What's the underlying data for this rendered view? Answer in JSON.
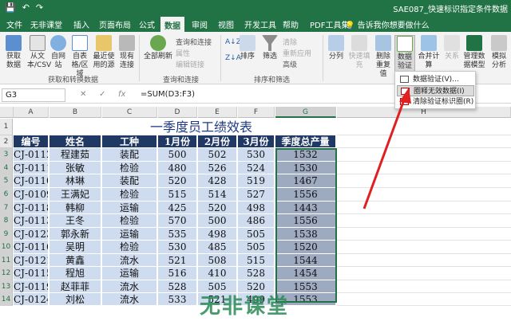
{
  "app": {
    "window_title": "SAE087_快速标识指定条件数据",
    "quick_access": [
      "💾",
      "↶",
      "↷"
    ]
  },
  "tabs": [
    "文件",
    "无非课堂",
    "插入",
    "页面布局",
    "公式",
    "数据",
    "审阅",
    "视图",
    "开发工具",
    "帮助",
    "PDF工具集"
  ],
  "active_tab": "数据",
  "tell_me": "告诉我你想要做什么",
  "ribbon": {
    "get_data": "获取数据",
    "from_text_csv": "从文本/CSV",
    "from_web": "自网站",
    "from_table": "自表格/区域",
    "recent_sources": "最近使用的源",
    "existing_connections": "现有连接",
    "refresh_all": "全部刷新",
    "queries_connections": "查询和连接",
    "properties": "属性",
    "edit_links": "编辑链接",
    "sort_az": "A↓Z",
    "sort_za": "Z↓A",
    "sort": "排序",
    "filter": "筛选",
    "clear": "清除",
    "reapply": "重新应用",
    "advanced": "高级",
    "text_to_columns": "分列",
    "flash_fill": "快速填充",
    "remove_duplicates": "删除重复值",
    "data_validation": "数据验证",
    "consolidate": "合并计算",
    "relationships": "关系",
    "manage_model": "管理数据模型",
    "what_if": "模拟分析",
    "group_get_transform": "获取和转换数据",
    "group_queries": "查询和连接",
    "group_sort_filter": "排序和筛选"
  },
  "dropdown": {
    "items": [
      "数据验证(V)...",
      "圈释无效数据(I)",
      "清除验证标识圈(R)"
    ],
    "highlighted_index": 1
  },
  "formula_bar": {
    "name_box": "G3",
    "formula": "=SUM(D3:F3)"
  },
  "columns": [
    "A",
    "B",
    "C",
    "D",
    "E",
    "F",
    "G",
    "H"
  ],
  "rows": [
    "1",
    "2",
    "3",
    "4",
    "5",
    "6",
    "7",
    "8",
    "9",
    "10",
    "11",
    "12",
    "13",
    "14"
  ],
  "sheet": {
    "title": "一季度员工绩效表",
    "headers": [
      "编号",
      "姓名",
      "工种",
      "1月份",
      "2月份",
      "3月份",
      "季度总产量"
    ],
    "data": [
      [
        "CJ-0112",
        "程建茹",
        "装配",
        "500",
        "502",
        "530",
        "1532"
      ],
      [
        "CJ-0111",
        "张敏",
        "检验",
        "480",
        "526",
        "524",
        "1530"
      ],
      [
        "CJ-0110",
        "林琳",
        "装配",
        "520",
        "428",
        "519",
        "1467"
      ],
      [
        "CJ-0109",
        "王满妃",
        "检验",
        "515",
        "514",
        "527",
        "1556"
      ],
      [
        "CJ-0118",
        "韩柳",
        "运输",
        "425",
        "520",
        "498",
        "1443"
      ],
      [
        "CJ-0113",
        "王冬",
        "检验",
        "570",
        "500",
        "486",
        "1556"
      ],
      [
        "CJ-0123",
        "郭永新",
        "运输",
        "535",
        "498",
        "505",
        "1538"
      ],
      [
        "CJ-0116",
        "吴明",
        "检验",
        "530",
        "485",
        "505",
        "1520"
      ],
      [
        "CJ-0121",
        "黄鑫",
        "流水",
        "521",
        "508",
        "515",
        "1544"
      ],
      [
        "CJ-0115",
        "程旭",
        "运输",
        "516",
        "410",
        "528",
        "1454"
      ],
      [
        "CJ-0119",
        "赵菲菲",
        "流水",
        "528",
        "505",
        "520",
        "1553"
      ],
      [
        "CJ-0124",
        "刘松",
        "流水",
        "533",
        "521",
        "499",
        "1553"
      ]
    ]
  },
  "watermark": "无非课堂",
  "colors": {
    "brand": "#217346",
    "header_bg": "#203864",
    "body_bg": "#cfdcef",
    "selected_bg": "#9daac0",
    "arrow": "#e02020"
  }
}
